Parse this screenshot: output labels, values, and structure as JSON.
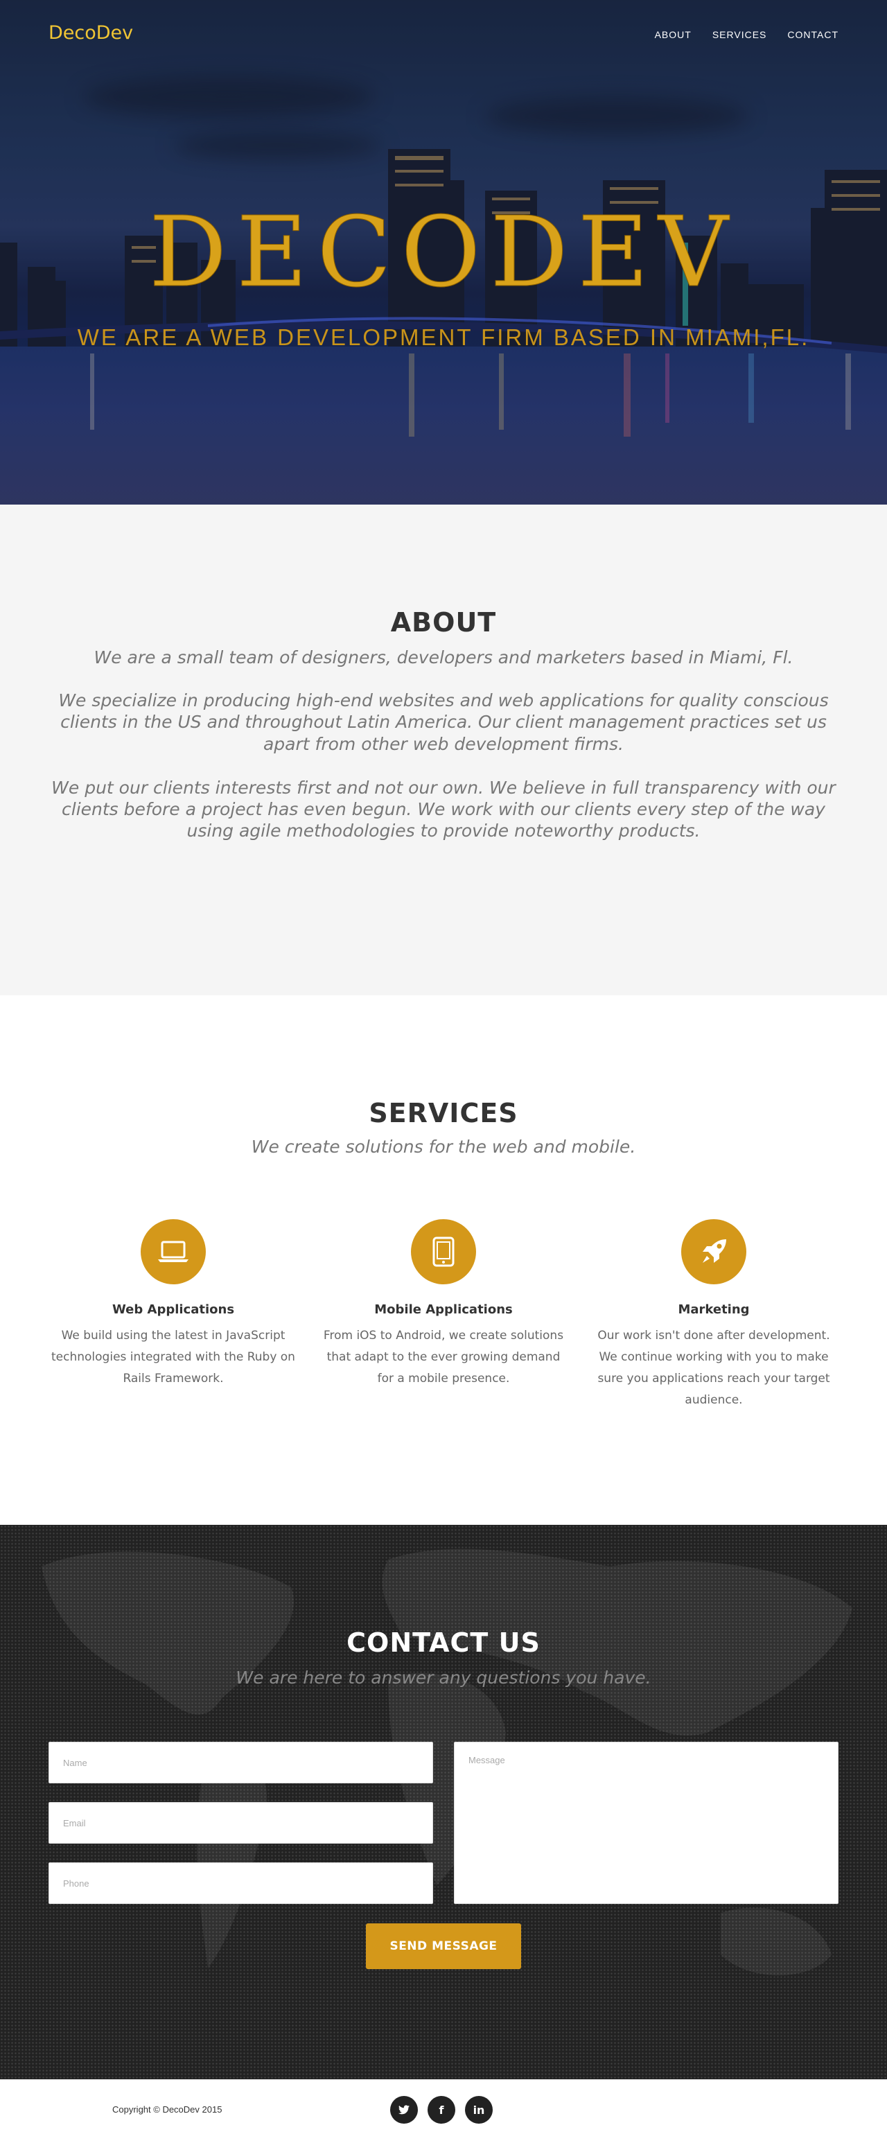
{
  "nav": {
    "brand": "DecoDev",
    "links": [
      "ABOUT",
      "SERVICES",
      "CONTACT"
    ]
  },
  "hero": {
    "title": "DECODEV",
    "subtitle": "WE ARE A WEB DEVELOPMENT FIRM BASED IN MIAMI,FL."
  },
  "about": {
    "heading": "ABOUT",
    "lead": "We are a small team of designers, developers and marketers based in Miami, Fl.",
    "paragraphs": [
      "We specialize in producing high-end websites and web applications for quality conscious clients in the US and throughout Latin America. Our client management practices set us apart from other web development firms.",
      "We put our clients interests first and not our own. We believe in full transparency with our clients before a project has even begun. We work with our clients every step of the way using agile methodologies to provide noteworthy products."
    ]
  },
  "services": {
    "heading": "SERVICES",
    "lead": "We create solutions for the web and mobile.",
    "items": [
      {
        "icon": "laptop-icon",
        "title": "Web Applications",
        "text": "We build using the latest in JavaScript technologies integrated with the Ruby on Rails Framework."
      },
      {
        "icon": "tablet-icon",
        "title": "Mobile Applications",
        "text": "From iOS to Android, we create solutions that adapt to the ever growing demand for a mobile presence."
      },
      {
        "icon": "rocket-icon",
        "title": "Marketing",
        "text": "Our work isn't done after development. We continue working with you to make sure you applications reach your target audience."
      }
    ]
  },
  "contact": {
    "heading": "CONTACT US",
    "lead": "We are here to answer any questions you have.",
    "placeholders": {
      "name": "Name",
      "email": "Email",
      "phone": "Phone",
      "message": "Message"
    },
    "send_label": "SEND MESSAGE"
  },
  "footer": {
    "copyright": "Copyright © DecoDev 2015",
    "social": [
      {
        "icon": "twitter-icon",
        "glyph": "t"
      },
      {
        "icon": "facebook-icon",
        "glyph": "f"
      },
      {
        "icon": "linkedin-icon",
        "glyph": "in"
      }
    ]
  },
  "colors": {
    "accent": "#d4981a",
    "brand": "#f0c534",
    "dark": "#222222",
    "light_bg": "#f5f5f5"
  }
}
